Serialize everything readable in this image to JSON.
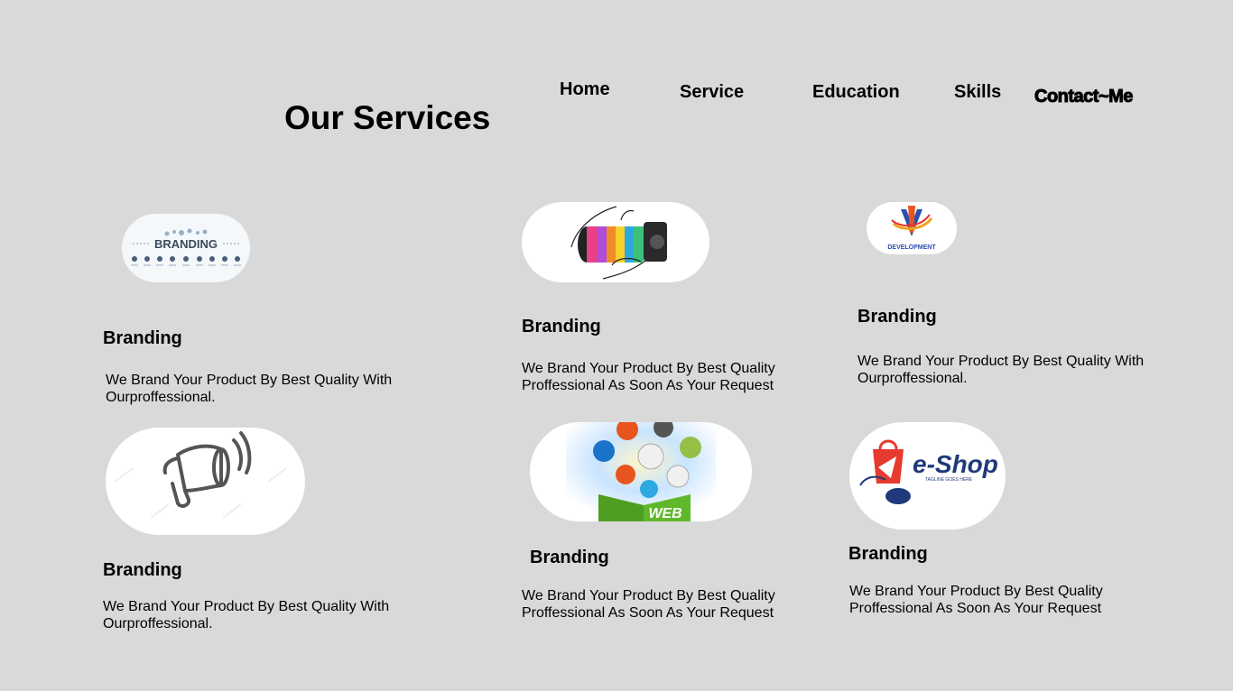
{
  "header": {
    "title": "Our Services",
    "nav": {
      "home": "Home",
      "service": "Service",
      "education": "Education",
      "skills": "Skills",
      "contact": "Contact~Me"
    }
  },
  "services": [
    {
      "image": "branding-banner-image",
      "image_text": "BRANDING",
      "title": "Branding",
      "description": "We Brand Your Product By Best Quality With Ourproffessional."
    },
    {
      "image": "camera-lens-image",
      "title": "Branding",
      "description": "We Brand Your Product By Best Quality Proffessional As Soon As Your Request"
    },
    {
      "image": "development-logo-image",
      "image_text": "DEVELOPMENT",
      "title": "Branding",
      "description": "We Brand Your Product By Best Quality With Ourproffessional."
    },
    {
      "image": "megaphone-image",
      "title": "Branding",
      "description": "We Brand Your Product By Best Quality With Ourproffessional."
    },
    {
      "image": "web-box-image",
      "image_text": "WEB",
      "title": "Branding",
      "description": "We Brand Your Product By Best Quality Proffessional As Soon As Your Request"
    },
    {
      "image": "eshop-logo-image",
      "image_text": "e-Shop",
      "image_subtext": "TAGLINE GOES HERE",
      "title": "Branding",
      "description": "We Brand Your Product By Best Quality Proffessional As Soon As Your Request"
    }
  ],
  "colors": {
    "background": "#d9d9d9",
    "card_image_bg": "#ffffff",
    "text": "#000000",
    "eshop_red": "#e63a2e",
    "eshop_blue": "#1f3a7a"
  }
}
